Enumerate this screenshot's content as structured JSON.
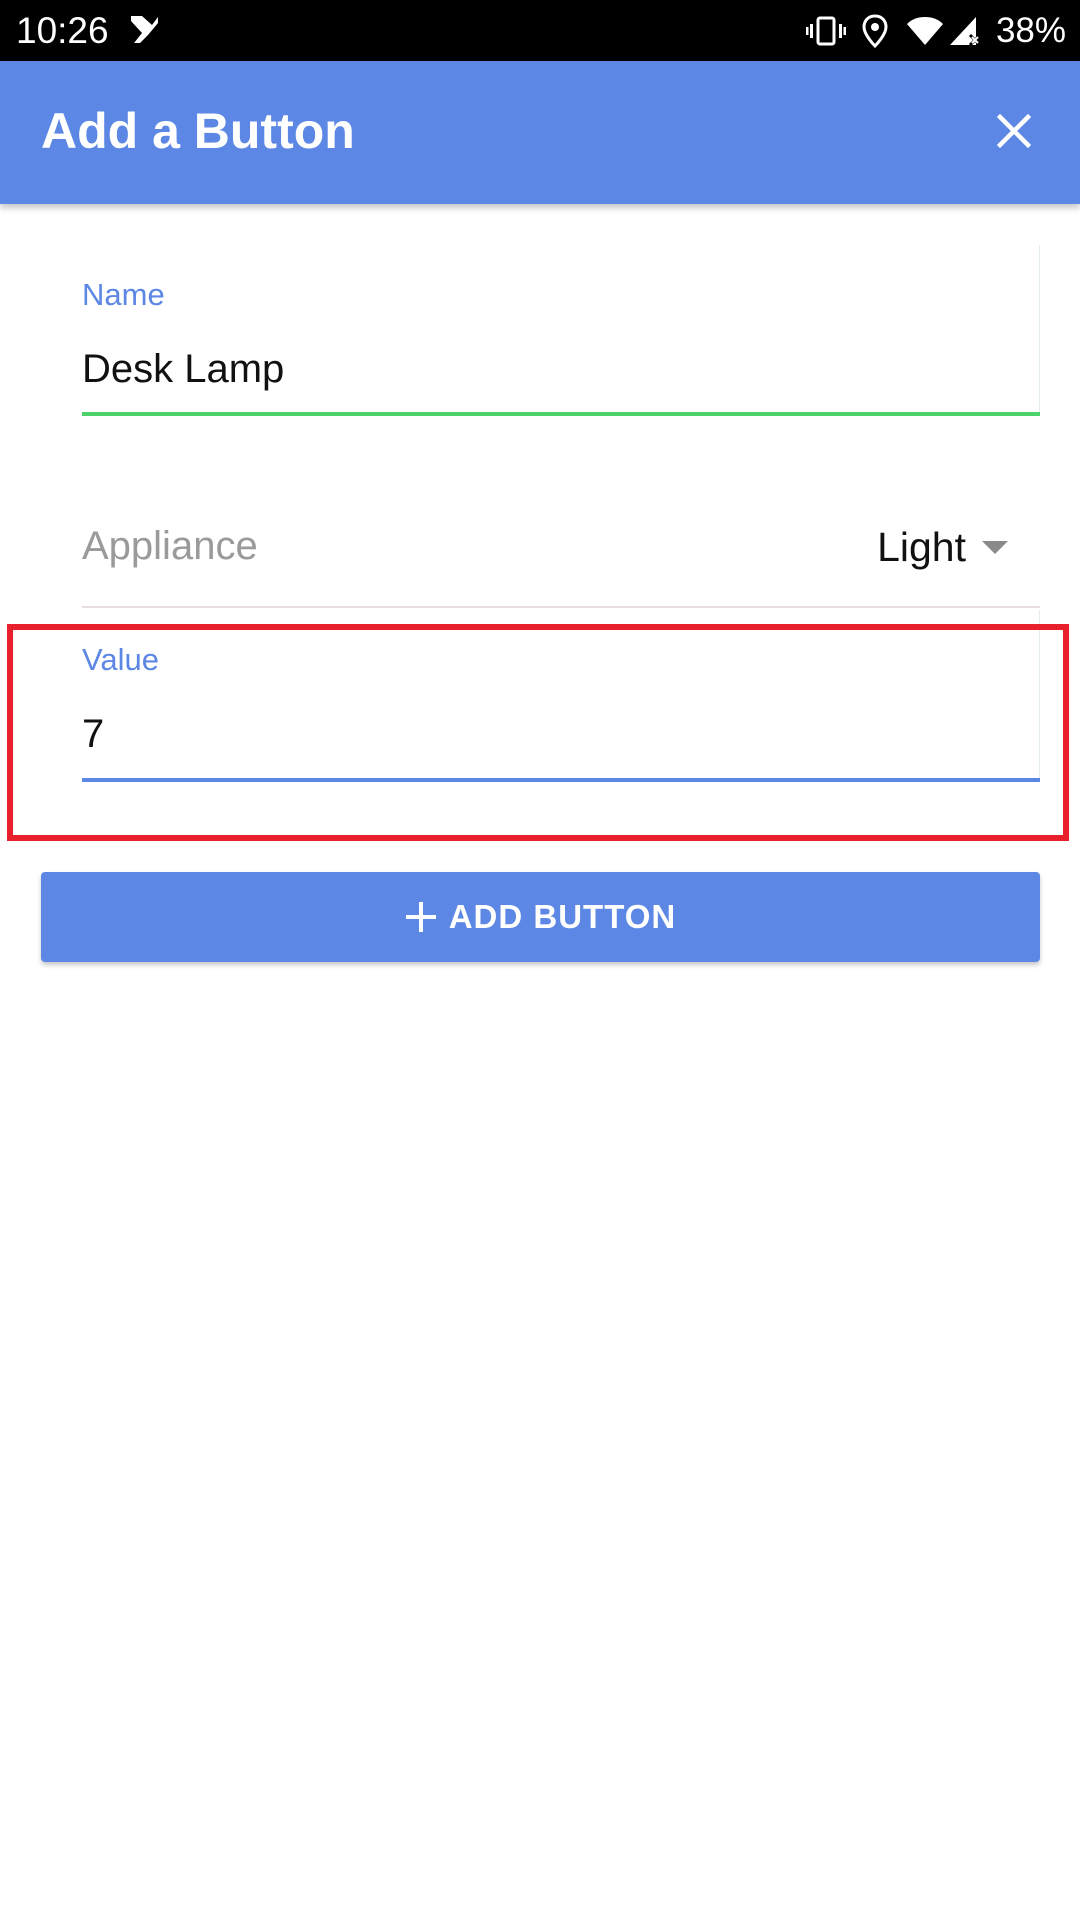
{
  "status_bar": {
    "time": "10:26",
    "battery": "38%",
    "icons": [
      "app-notification-icon",
      "vibrate-icon",
      "location-icon",
      "wifi-icon",
      "cell-signal-icon"
    ]
  },
  "app_bar": {
    "title": "Add a Button",
    "close_icon": "close-icon"
  },
  "form": {
    "name": {
      "label": "Name",
      "value": "Desk Lamp"
    },
    "appliance": {
      "label": "Appliance",
      "selected": "Light"
    },
    "value": {
      "label": "Value",
      "value": "7"
    }
  },
  "add_button": {
    "label": "ADD BUTTON",
    "icon": "plus-icon"
  },
  "colors": {
    "primary": "#5c87e4",
    "valid_underline": "#4cd36b",
    "focused_underline": "#5c87e4",
    "highlight": "#e8202b"
  }
}
